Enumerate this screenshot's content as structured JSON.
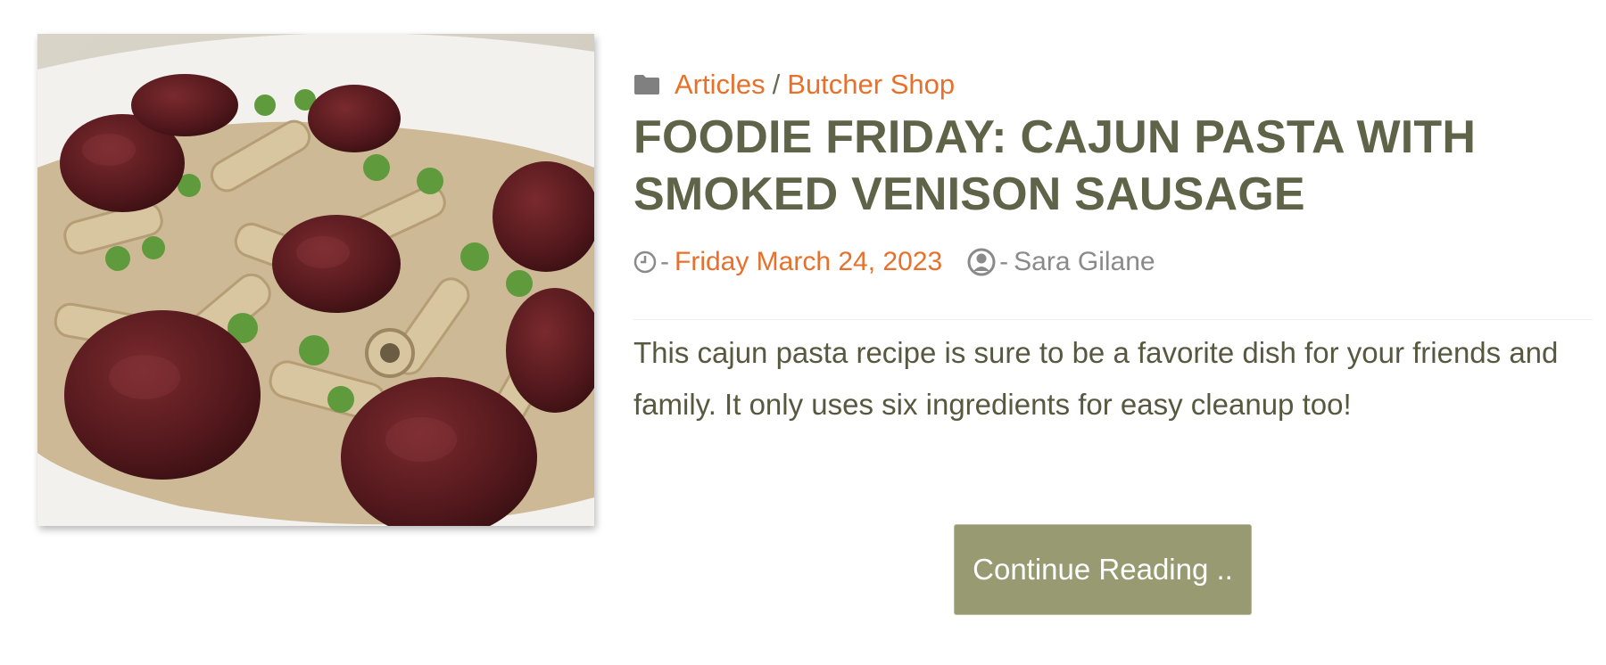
{
  "colors": {
    "accent": "#e8702a",
    "title": "#5f6347",
    "text": "#56593f",
    "meta_gray": "#8a8a8a",
    "button_bg": "#989a72"
  },
  "post": {
    "image_alt": "Cajun pasta with smoked venison sausage and peas",
    "categories": [
      "Articles",
      "Butcher Shop"
    ],
    "category_separator": "/",
    "title": "FOODIE FRIDAY: CAJUN PASTA WITH SMOKED VENISON SAUSAGE",
    "date_prefix": "-",
    "date": "Friday March 24, 2023",
    "author_prefix": "-",
    "author": "Sara Gilane",
    "excerpt": "This cajun pasta recipe is sure to be a favorite dish for your friends and family. It only uses six ingredients for easy cleanup too!",
    "button_label": "Continue Reading .."
  },
  "icons": {
    "category": "folder-icon",
    "date": "clock-icon",
    "author": "user-circle-icon"
  }
}
